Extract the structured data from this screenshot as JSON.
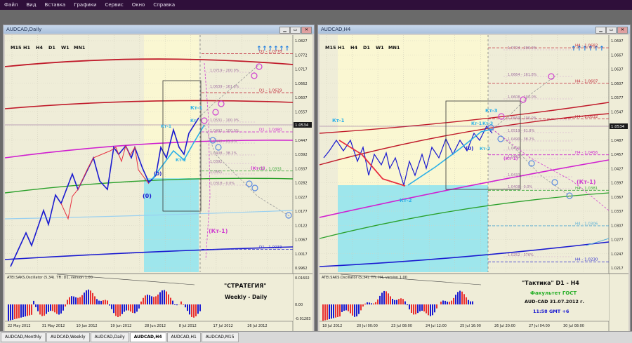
{
  "menu": [
    "Файл",
    "Вид",
    "Вставка",
    "Графики",
    "Сервис",
    "Окно",
    "Справка"
  ],
  "left": {
    "title": "AUDCAD,Daily",
    "tf": [
      "M15",
      "H1",
      "H4",
      "D1",
      "W1",
      "MN1"
    ],
    "levels": [
      {
        "label": "D1 - 1.0778",
        "v": 1.0778,
        "color": "#c0283a"
      },
      {
        "label": "D1 - 1.0629",
        "v": 1.0629,
        "color": "#c0283a"
      },
      {
        "label": "D1 - 1.0480",
        "v": 1.048,
        "color": "#d02ad0"
      },
      {
        "label": "D1 - 1.0331",
        "v": 1.0331,
        "color": "#3aa83a"
      },
      {
        "label": "D1 - 1.0033",
        "v": 1.0033,
        "color": "#2a2ad0"
      }
    ],
    "fibo": [
      "1.0719 - 200.0%",
      "1.0639 - 161.8%",
      "1.0531 - 100.0%",
      "1.0492 - 100.0%",
      "1.0440 - 61.8%",
      "1.0408 - 38.2%",
      "1.0392",
      "1.0351",
      "1.0318 - 0.0%"
    ],
    "prices": [
      "1.0827",
      "1.0772",
      "1.0717",
      "1.0662",
      "1.0607",
      "1.0557",
      "1.0502",
      "1.0447",
      "1.0392",
      "1.0337",
      "1.0282",
      "1.0227",
      "1.0177",
      "1.0122",
      "1.0067",
      "1.0017",
      "0.9962"
    ],
    "price_tag": "1.0534",
    "labels": {
      "kt1": "Кт-1",
      "kt1b": "Кт-1",
      "kt2": "Кт-2",
      "kt": "Кт",
      "zero": "(0)",
      "zero2": "(0)",
      "ktm1": "(Кт-1)",
      "ktm1b": "(Кт-1)"
    },
    "osc_title": "ATEI.SAKS.Oscillator (5,34). TFi: D1, version 1.00",
    "osc_scale": [
      "0.01602",
      "0.00",
      "-0.01283"
    ],
    "strategy": "\"СТРАТЕГИЯ\"",
    "subtitle": "Weekly - Daily",
    "dates": [
      "22 May 2012",
      "31 May 2012",
      "10 Jun 2012",
      "19 Jun 2012",
      "28 Jun 2012",
      "8 Jul 2012",
      "17 Jul 2012",
      "26 Jul 2012"
    ]
  },
  "right": {
    "title": "AUDCAD,H4",
    "tf": [
      "M15",
      "H1",
      "H4",
      "D1",
      "W1",
      "MN1"
    ],
    "levels": [
      {
        "label": "H4 - 1.0682",
        "v": 1.0682,
        "color": "#c0283a"
      },
      {
        "label": "H4 - 1.0607",
        "v": 1.0607,
        "color": "#c0283a"
      },
      {
        "label": "H4 - 1.0532",
        "v": 1.0532,
        "color": "#c0283a"
      },
      {
        "label": "H4 - 1.0456",
        "v": 1.0456,
        "color": "#d02ad0"
      },
      {
        "label": "H4 - 1.0381",
        "v": 1.0381,
        "color": "#3aa83a"
      },
      {
        "label": "H4 - 1.0306",
        "v": 1.0306,
        "color": "#5ab0d8"
      },
      {
        "label": "H4 - 1.0230",
        "v": 1.023,
        "color": "#2a2ad0"
      }
    ],
    "fibo": [
      "1.0724 - 200.0%",
      "1.0664 - 161.8%",
      "1.0608 - 100.0%",
      "1.0560 - 100.0%",
      "1.0519 - 61.8%",
      "1.0490 - 38.2%",
      "1.0490",
      "1.0463",
      "1.0433",
      "1.0408 - 0.0%",
      "1.0252 - 376%"
    ],
    "prices": [
      "1.0697",
      "1.0667",
      "1.0637",
      "1.0607",
      "1.0577",
      "1.0547",
      "1.0517",
      "1.0487",
      "1.0457",
      "1.0427",
      "1.0397",
      "1.0367",
      "1.0337",
      "1.0307",
      "1.0277",
      "1.0247",
      "1.0217"
    ],
    "price_tag": "1.0534",
    "labels": {
      "kt1": "Кт-1",
      "kt3": "Кт-3",
      "kt1b": "Кт-1",
      "kt3b": "Кт-3",
      "kt2": "Кт-2",
      "kt2b": "Кт-2",
      "zero": "(0)",
      "ktm1": "(Кт-1)",
      "ktm1b": "(Кт-1)"
    },
    "osc_title": "ATEI.SAKS.Oscillator (5,34). TFi: H4, version 1.00",
    "tactic": "\"Тактика\"  D1 - H4",
    "faculty": "Факультет ГОСТ",
    "pair_date": "AUD-CAD 31.07.2012  г.",
    "time": "11:58   GMT +6",
    "dates": [
      "18 Jul 2012",
      "20 Jul 00:00",
      "23 Jul 08:00",
      "24 Jul 12:00",
      "25 Jul 16:00",
      "26 Jul 20:00",
      "27 Jul 04:00",
      "30 Jul 08:00"
    ]
  },
  "tabs": [
    "AUDCAD,Monthly",
    "AUDCAD,Weekly",
    "AUDCAD,Daily",
    "AUDCAD,H4",
    "AUDCAD,H1",
    "AUDCAD,M15"
  ],
  "active_tab": "AUDCAD,H4"
}
